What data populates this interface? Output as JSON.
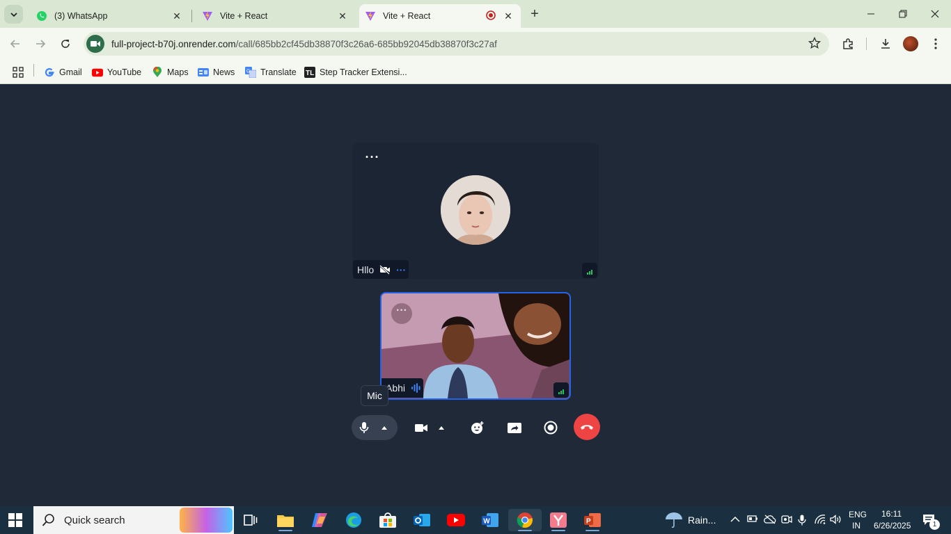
{
  "browser": {
    "tabs": [
      {
        "title": "(3) WhatsApp",
        "icon": "whatsapp-icon",
        "active": false
      },
      {
        "title": "Vite + React",
        "icon": "vite-icon",
        "active": false
      },
      {
        "title": "Vite + React",
        "icon": "vite-icon",
        "active": true,
        "recording": true
      }
    ],
    "url_host": "full-project-b70j.onrender.com",
    "url_path": "/call/685bb2cf45db38870f3c26a6-685bb92045db38870f3c27af",
    "bookmarks": [
      {
        "label": "Gmail",
        "icon": "gmail-icon"
      },
      {
        "label": "YouTube",
        "icon": "youtube-icon"
      },
      {
        "label": "Maps",
        "icon": "maps-icon"
      },
      {
        "label": "News",
        "icon": "news-icon"
      },
      {
        "label": "Translate",
        "icon": "translate-icon"
      },
      {
        "label": "Step Tracker Extensi...",
        "icon": "step-tracker-icon"
      }
    ]
  },
  "call": {
    "remote": {
      "name": "Hllo",
      "camera_off": true
    },
    "local": {
      "name": "Abhi",
      "speaking": true
    },
    "tooltip": "Mic",
    "accent": "#2563eb",
    "hangup_color": "#ef4444"
  },
  "taskbar": {
    "search_placeholder": "Quick search",
    "weather": "Rain...",
    "lang_top": "ENG",
    "lang_bottom": "IN",
    "time": "16:11",
    "date": "6/26/2025",
    "notification_count": "1"
  }
}
